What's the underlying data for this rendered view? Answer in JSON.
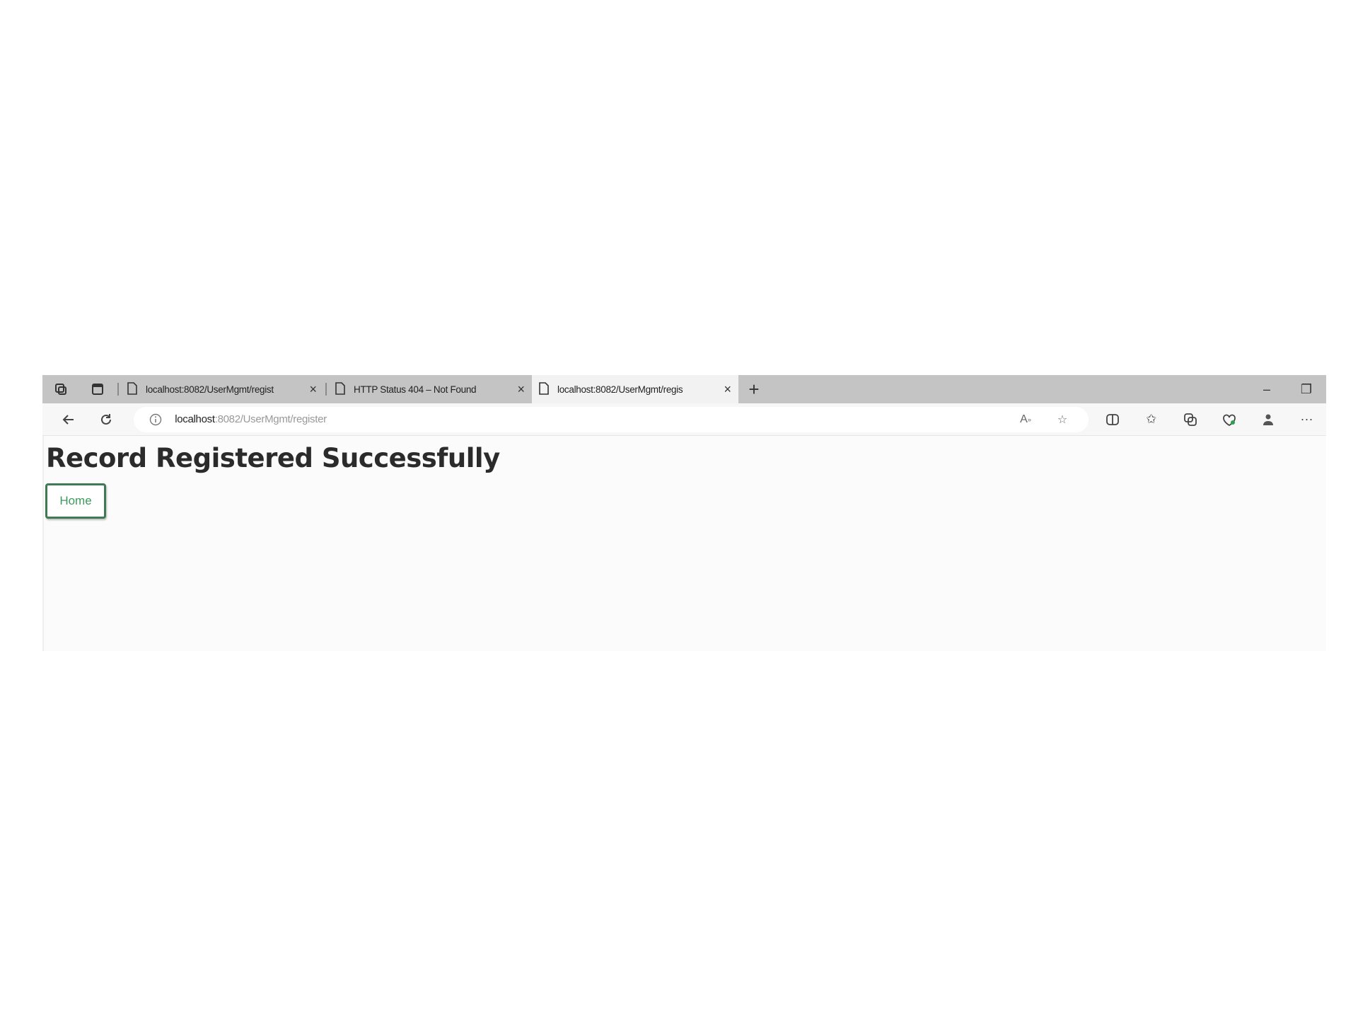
{
  "browser": {
    "tabs": [
      {
        "label": "localhost:8082/UserMgmt/regist",
        "active": false
      },
      {
        "label": "HTTP Status 404 – Not Found",
        "active": false
      },
      {
        "label": "localhost:8082/UserMgmt/regis",
        "active": true
      }
    ],
    "new_tab_symbol": "+",
    "window_controls": {
      "minimize": "–",
      "restore": "❐"
    },
    "address": {
      "host": "localhost",
      "path": ":8082/UserMgmt/register"
    },
    "toolbar_icons": [
      "read-aloud-icon",
      "favorite-star-icon",
      "split-screen-icon",
      "favorites-icon",
      "collections-icon",
      "extensions-icon",
      "profile-icon",
      "more-menu-icon"
    ]
  },
  "page": {
    "heading": "Record Registered Successfully",
    "home_button": "Home"
  },
  "colors": {
    "tabbar_bg": "#c4c4c4",
    "button_border": "#3f7a52",
    "button_text": "#3d9a5c"
  }
}
